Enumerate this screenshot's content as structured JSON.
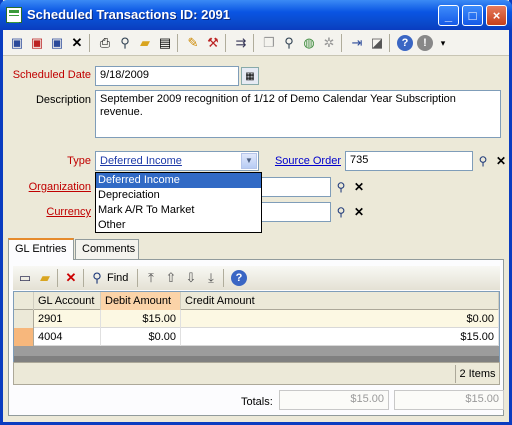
{
  "window": {
    "title": "Scheduled Transactions ID: 2091"
  },
  "toolbar_icons": [
    "save-icon",
    "save-close-icon",
    "save-new-icon",
    "find-icon",
    "open-folder-icon",
    "delete-icon",
    "print-icon",
    "print-preview-icon",
    "new-folder-icon",
    "report-icon",
    "edit-icon",
    "tools-icon",
    "link-icon",
    "copy-icon",
    "lookup-icon",
    "globe-icon",
    "refresh-icon",
    "export-icon",
    "note-icon",
    "help-icon",
    "stop-icon",
    "more-icon"
  ],
  "form": {
    "scheduled_date": {
      "label": "Scheduled Date",
      "value": "9/18/2009"
    },
    "description": {
      "label": "Description",
      "value": "September 2009 recognition of 1/12 of Demo Calendar Year Subscription revenue."
    },
    "type": {
      "label": "Type",
      "value": "Deferred Income",
      "options": [
        "Deferred Income",
        "Depreciation",
        "Mark A/R To Market",
        "Other"
      ]
    },
    "source_order": {
      "label": "Source Order",
      "value": "735"
    },
    "organization": {
      "label": "Organization",
      "value": ""
    },
    "currency": {
      "label": "Currency",
      "value": ""
    }
  },
  "tabs": [
    {
      "label": "GL Entries"
    },
    {
      "label": "Comments"
    }
  ],
  "grid_toolbar": {
    "find_label": "Find"
  },
  "grid": {
    "columns": [
      "GL Account",
      "Debit Amount",
      "Credit Amount"
    ],
    "rows": [
      {
        "account": "2901",
        "debit": "$15.00",
        "credit": "$0.00"
      },
      {
        "account": "4004",
        "debit": "$0.00",
        "credit": "$15.00"
      }
    ],
    "count": "2 Items"
  },
  "totals": {
    "label": "Totals:",
    "debit": "$15.00",
    "credit": "$15.00"
  },
  "colors": {
    "title_bar": "#0a55e3",
    "required_label": "#c00000",
    "selection": "#316ac5",
    "sorted_column": "#fbd3a8"
  }
}
